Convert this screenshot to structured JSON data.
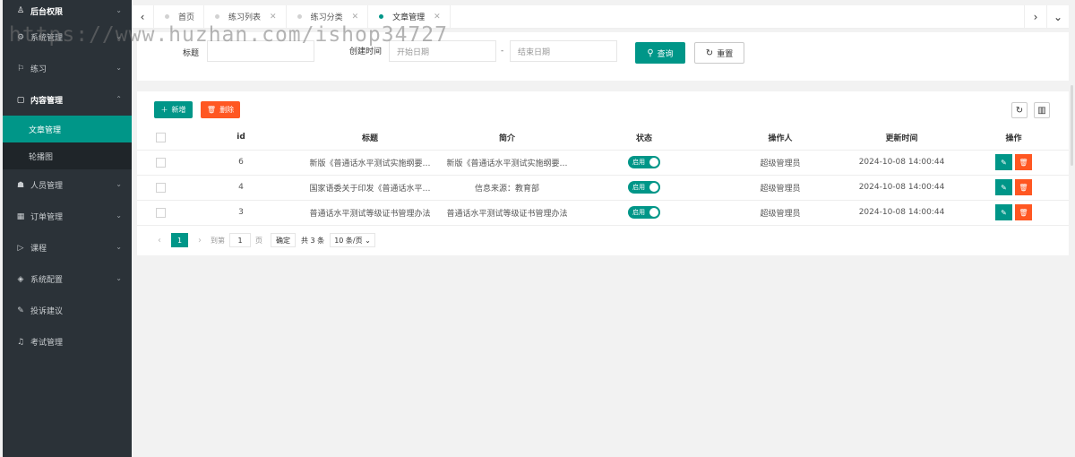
{
  "sidebar": {
    "items": [
      {
        "label": "后台权限",
        "icon": "user-icon",
        "glyph": "♙",
        "open": true
      },
      {
        "label": "系统管理",
        "icon": "gear-icon",
        "glyph": "⚙"
      },
      {
        "label": "练习",
        "icon": "flag-icon",
        "glyph": "⚐"
      },
      {
        "label": "内容管理",
        "icon": "file-icon",
        "glyph": "▢",
        "open": true,
        "expanded": true
      },
      {
        "label": "人员管理",
        "icon": "users-icon",
        "glyph": "👥"
      },
      {
        "label": "订单管理",
        "icon": "calendar-icon",
        "glyph": "▦"
      },
      {
        "label": "课程",
        "icon": "play-icon",
        "glyph": "▷"
      },
      {
        "label": "系统配置",
        "icon": "layers-icon",
        "glyph": "◈"
      },
      {
        "label": "投诉建议",
        "icon": "edit-note-icon",
        "glyph": "✎"
      },
      {
        "label": "考试管理",
        "icon": "headset-icon",
        "glyph": "♫"
      }
    ],
    "subitems": [
      {
        "label": "文章管理",
        "active": true
      },
      {
        "label": "轮播图",
        "active": false
      }
    ]
  },
  "tabs": {
    "items": [
      {
        "label": "首页"
      },
      {
        "label": "练习列表"
      },
      {
        "label": "练习分类"
      },
      {
        "label": "文章管理",
        "active": true
      }
    ]
  },
  "search": {
    "title_label": "标题",
    "title_placeholder": "",
    "created_label": "创建时间",
    "start_placeholder": "开始日期",
    "dash": "-",
    "end_placeholder": "结束日期",
    "query_label": "查询",
    "reset_label": "重置"
  },
  "toolbar": {
    "add_label": "新增",
    "delete_label": "删除"
  },
  "table": {
    "columns": [
      "id",
      "标题",
      "简介",
      "状态",
      "操作人",
      "更新时间",
      "操作"
    ],
    "rows": [
      {
        "id": "6",
        "title": "新版《普通话水平测试实施纲要…",
        "intro": "新版《普通话水平测试实施纲要…",
        "status": "启用",
        "operator": "超级管理员",
        "updated": "2024-10-08 14:00:44"
      },
      {
        "id": "4",
        "title": "国家语委关于印发《普通话水平…",
        "intro": "信息来源：教育部",
        "status": "启用",
        "operator": "超级管理员",
        "updated": "2024-10-08 14:00:44"
      },
      {
        "id": "3",
        "title": "普通话水平测试等级证书管理办法",
        "intro": "普通话水平测试等级证书管理办法",
        "status": "启用",
        "operator": "超级管理员",
        "updated": "2024-10-08 14:00:44"
      }
    ]
  },
  "pager": {
    "current": "1",
    "goto_label": "到第",
    "goto_value": "1",
    "page_label": "页",
    "confirm_label": "确定",
    "total_label": "共 3 条",
    "size_label": "10 条/页"
  },
  "watermark": "https://www.huzhan.com/ishop34727",
  "colors": {
    "accent": "#009688",
    "danger": "#ff5722",
    "sidebar": "#2b3238"
  }
}
